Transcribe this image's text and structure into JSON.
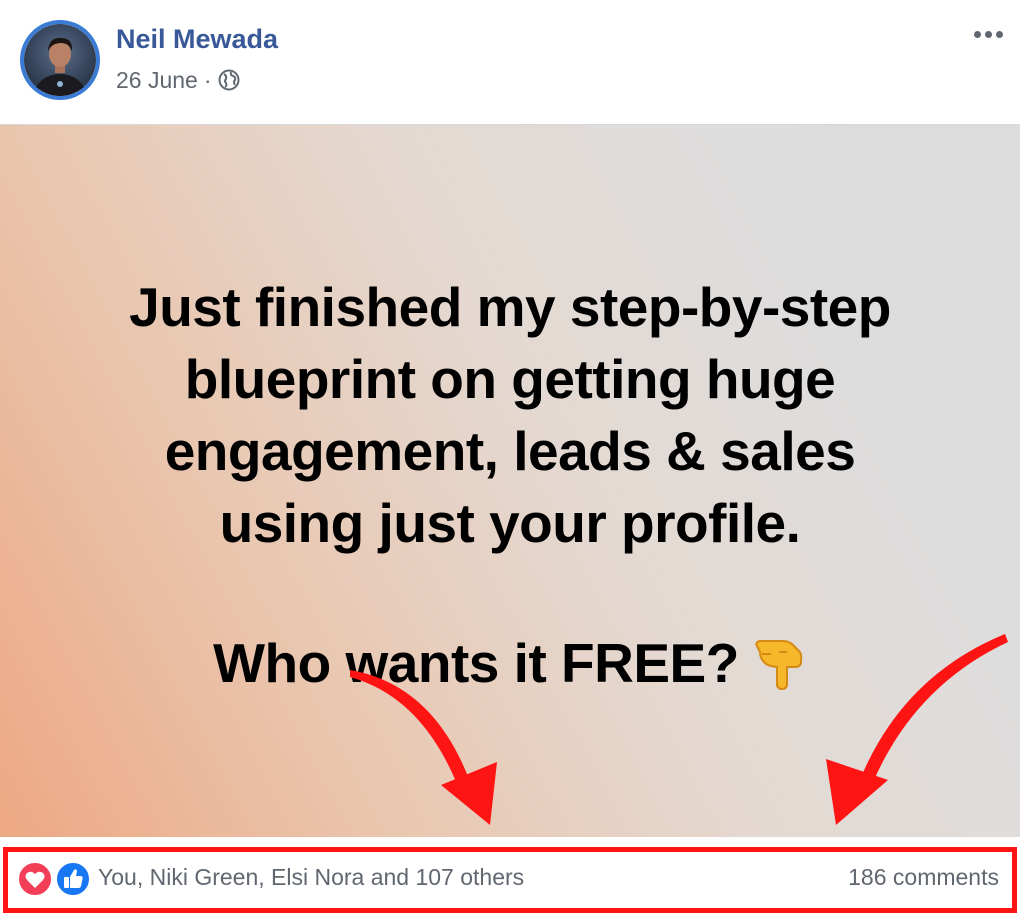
{
  "post": {
    "author": {
      "name": "Neil Mewada"
    },
    "date": "26 June",
    "separator": "·",
    "audience_icon": "globe-icon",
    "menu_icon": "more-options-icon",
    "image": {
      "text_lines": [
        "Just finished my step-by-step",
        "blueprint on getting huge",
        "engagement, leads & sales",
        "using just your profile."
      ],
      "question": "Who wants it FREE?",
      "emoji_icon": "backhand-index-pointing-down-icon",
      "overlay_arrow_color": "#ff1414"
    },
    "reactions": {
      "icons": [
        "love-reaction-icon",
        "like-reaction-icon"
      ],
      "names_text": "You, Niki Green, Elsi Nora and 107 others",
      "comments_text": "186 comments"
    }
  },
  "colors": {
    "author_link": "#385898",
    "meta_text": "#606770",
    "highlight": "#ff1414",
    "like_blue": "#1877f2",
    "love_red": "#f33e58"
  }
}
